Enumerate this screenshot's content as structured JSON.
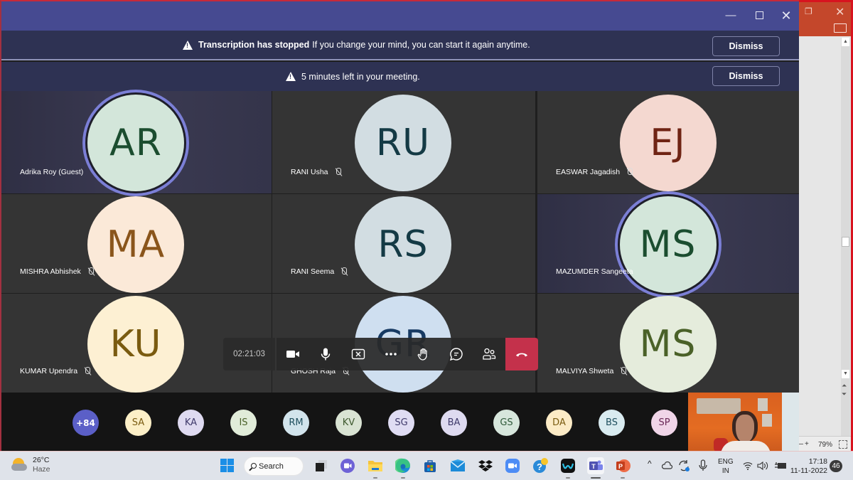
{
  "window": {
    "minimize_icon": "minimize-icon",
    "maximize_icon": "maximize-icon",
    "close_icon": "close-icon",
    "title_color": "#464a91"
  },
  "banners": [
    {
      "icon": "warning-icon",
      "title": "Transcription has stopped",
      "message": "If you change your mind, you can start it again anytime.",
      "button": "Dismiss"
    },
    {
      "icon": "warning-icon",
      "title": "",
      "message": "5 minutes left in your meeting.",
      "button": "Dismiss"
    }
  ],
  "tiles": [
    {
      "initials": "AR",
      "name": "Adrika Roy (Guest)",
      "muted": false,
      "speaking": true,
      "bg": "#d3e6da",
      "fg": "#1b4d2f"
    },
    {
      "initials": "RU",
      "name": "RANI Usha",
      "muted": true,
      "speaking": false,
      "bg": "#d2dde2",
      "fg": "#143a45"
    },
    {
      "initials": "EJ",
      "name": "EASWAR Jagadish",
      "muted": true,
      "speaking": false,
      "bg": "#f4d8d0",
      "fg": "#6f2414"
    },
    {
      "initials": "MA",
      "name": "MISHRA Abhishek",
      "muted": true,
      "speaking": false,
      "bg": "#fbe9d8",
      "fg": "#8a551b"
    },
    {
      "initials": "RS",
      "name": "RANI Seema",
      "muted": true,
      "speaking": false,
      "bg": "#d2dde2",
      "fg": "#143a45"
    },
    {
      "initials": "MS",
      "name": "MAZUMDER Sangeeta",
      "muted": false,
      "speaking": true,
      "bg": "#d3e6da",
      "fg": "#1b4d2f"
    },
    {
      "initials": "KU",
      "name": "KUMAR Upendra",
      "muted": true,
      "speaking": false,
      "bg": "#fdf0d3",
      "fg": "#7a5b10"
    },
    {
      "initials": "GR",
      "name": "GHOSH Raja",
      "muted": true,
      "speaking": false,
      "bg": "#cfdff0",
      "fg": "#173a63"
    },
    {
      "initials": "MS",
      "name": "MALVIYA Shweta",
      "muted": true,
      "speaking": false,
      "bg": "#e5ecdc",
      "fg": "#4a6128"
    }
  ],
  "controls": {
    "timer": "02:21:03",
    "buttons": [
      {
        "name": "camera-button",
        "icon": "video-camera-icon"
      },
      {
        "name": "mic-button",
        "icon": "microphone-icon"
      },
      {
        "name": "share-button",
        "icon": "stop-share-icon"
      },
      {
        "name": "more-button",
        "icon": "more-icon"
      },
      {
        "name": "raise-hand-button",
        "icon": "raise-hand-icon"
      },
      {
        "name": "chat-button",
        "icon": "chat-icon"
      },
      {
        "name": "participants-button",
        "icon": "people-icon"
      }
    ],
    "hangup_icon": "hang-up-icon",
    "hangup_color": "#c4314b"
  },
  "overflow": [
    {
      "label": "+84",
      "bg": "#5b5fc7",
      "fg": "#ffffff"
    },
    {
      "label": "SA",
      "bg": "#fcefc7",
      "fg": "#7a5b10"
    },
    {
      "label": "KA",
      "bg": "#dedaf0",
      "fg": "#3f3a6b"
    },
    {
      "label": "IS",
      "bg": "#e1ecd9",
      "fg": "#4a6128"
    },
    {
      "label": "RM",
      "bg": "#d2e4ec",
      "fg": "#1f4f5e"
    },
    {
      "label": "KV",
      "bg": "#d9e3d3",
      "fg": "#3f5a30"
    },
    {
      "label": "SG",
      "bg": "#dfdcf3",
      "fg": "#3f3a6b"
    },
    {
      "label": "BA",
      "bg": "#dedaf0",
      "fg": "#3f3a6b"
    },
    {
      "label": "GS",
      "bg": "#d7e6dc",
      "fg": "#305a3b"
    },
    {
      "label": "DA",
      "bg": "#fcebc6",
      "fg": "#7a5b10"
    },
    {
      "label": "BS",
      "bg": "#d9ebf0",
      "fg": "#1f4f5e"
    },
    {
      "label": "SP",
      "bg": "#f0d5e8",
      "fg": "#6b2a58"
    }
  ],
  "ppt": {
    "zoom": "79%",
    "zoom_minus": "—",
    "zoom_plus": "+"
  },
  "taskbar": {
    "weather": {
      "temp": "26°C",
      "condition": "Haze"
    },
    "search_label": "Search",
    "apps": [
      "windows-start-icon",
      "task-view-icon",
      "teams-chat-icon",
      "file-explorer-icon",
      "edge-icon",
      "store-icon",
      "mail-icon",
      "dropbox-icon",
      "zoom-icon",
      "help-icon",
      "webex-icon",
      "teams-icon",
      "powerpoint-icon"
    ],
    "lang": [
      "ENG",
      "IN"
    ],
    "time": "17:18",
    "date": "11-11-2022",
    "notifications": "46"
  }
}
